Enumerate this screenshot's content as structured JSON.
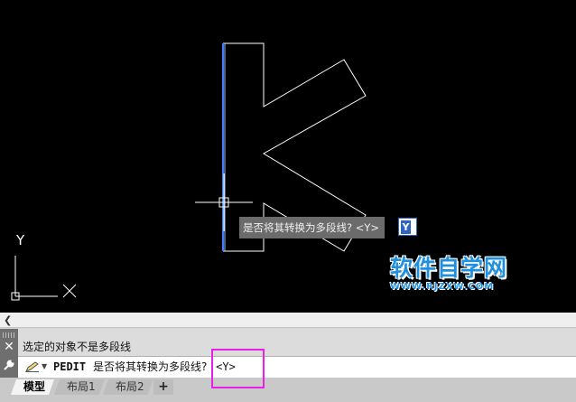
{
  "drawing": {
    "tooltip_prompt": "是否将其转换为多段线? <Y>",
    "dynamic_input_value": "Y",
    "ucs_x_label": "X",
    "ucs_y_label": "Y"
  },
  "watermark": {
    "main": "软件自学网",
    "sub": "WWW.RJZXW.COM"
  },
  "command": {
    "history_line": "选定的对象不是多段线",
    "command_name": "PEDIT",
    "prompt": "是否将其转换为多段线?",
    "default_option": "<Y>"
  },
  "tabs": [
    {
      "label": "模型",
      "active": true
    },
    {
      "label": "布局1",
      "active": false
    },
    {
      "label": "布局2",
      "active": false
    }
  ],
  "tab_add_label": "+",
  "colors": {
    "viewport_bg": "#000000",
    "selected_line": "#3f7fff",
    "drawing_line": "#ffffff",
    "highlight": "#e620e6",
    "watermark": "#1f90e0"
  }
}
